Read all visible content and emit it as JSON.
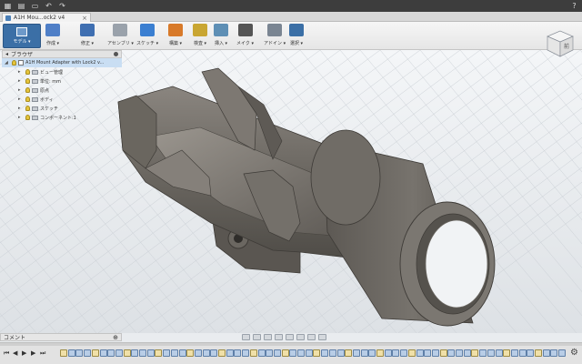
{
  "app": {
    "icons": [
      "grid-menu-icon",
      "file-menu-icon",
      "save-icon",
      "undo-icon",
      "redo-icon",
      "help-icon"
    ]
  },
  "document_tab": {
    "title": "A1H Mou...ock2 v4"
  },
  "workspace": {
    "label": "モデル ▾"
  },
  "ribbon": {
    "tools": [
      {
        "id": "create",
        "label": "作成 ▾",
        "color": "#4f7fc7"
      },
      {
        "id": "modify",
        "label": "修正 ▾",
        "color": "#3f6fb1"
      },
      {
        "id": "assemble",
        "label": "アセンブリ ▾",
        "color": "#9aa2ab"
      },
      {
        "id": "sketch",
        "label": "スケッチ ▾",
        "color": "#3b7fd1"
      },
      {
        "id": "construct",
        "label": "構築 ▾",
        "color": "#d87a2a"
      },
      {
        "id": "inspect",
        "label": "検査 ▾",
        "color": "#c9a632"
      },
      {
        "id": "insert",
        "label": "挿入 ▾",
        "color": "#5e8fb5"
      },
      {
        "id": "make",
        "label": "メイク ▾",
        "color": "#555555"
      },
      {
        "id": "addins",
        "label": "アドイン ▾",
        "color": "#7a8592"
      },
      {
        "id": "select",
        "label": "選択 ▾",
        "color": "#3b6fa6"
      }
    ]
  },
  "viewcube": {
    "face_label": "前"
  },
  "browser": {
    "title": "ブラウザ",
    "root": "A1H Mount Adapter with Lock2 v...",
    "items": [
      {
        "label": "ビュー管理",
        "type": "settings"
      },
      {
        "label": "単位: mm",
        "type": "units"
      },
      {
        "label": "原点",
        "type": "folder"
      },
      {
        "label": "ボディ",
        "type": "folder"
      },
      {
        "label": "スケッチ",
        "type": "folder"
      },
      {
        "label": "コンポーネント:1",
        "type": "component"
      }
    ]
  },
  "comments": {
    "label": "コメント"
  },
  "timeline": {
    "controls": [
      "⏮",
      "◀",
      "▶",
      "▶",
      "⏭"
    ],
    "feature_count": 64
  },
  "colors": {
    "accent": "#3b6fa6",
    "model_body": "#6e6a64",
    "model_dark": "#4c4944",
    "model_light": "#8d8882"
  }
}
